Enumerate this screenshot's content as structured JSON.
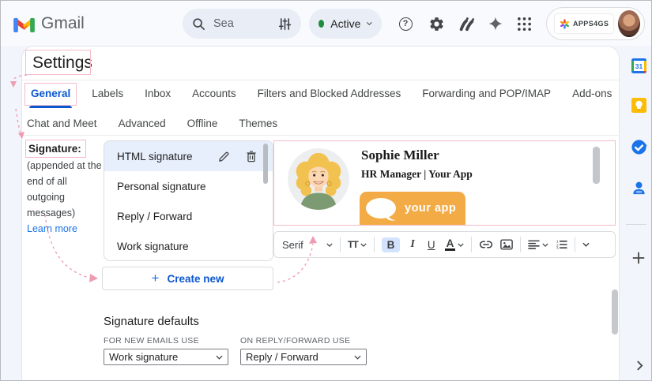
{
  "colors": {
    "annotation_pink": "#ef9fb4",
    "accent_blue": "#0b57d0",
    "banner_orange": "#f3ab45",
    "active_green": "#1e8e3e",
    "selected_row_blue": "#e7eefc"
  },
  "header": {
    "app_name": "Gmail",
    "search_text": "Sea",
    "status_label": "Active",
    "account_badge": "APPS4GS",
    "help_glyph": "?",
    "icons": [
      "search-icon",
      "tune-icon",
      "help-icon",
      "settings-gear-icon",
      "extension-icon",
      "gemini-sparkle-icon",
      "apps-grid-icon",
      "profile-photo"
    ]
  },
  "page": {
    "title": "Settings"
  },
  "tabs": {
    "active": "General",
    "row1": [
      "General",
      "Labels",
      "Inbox",
      "Accounts",
      "Filters and Blocked Addresses",
      "Forwarding and POP/IMAP",
      "Add-ons"
    ],
    "row2": [
      "Chat and Meet",
      "Advanced",
      "Offline",
      "Themes"
    ]
  },
  "signature": {
    "label": "Signature:",
    "note_lines": [
      "(appended at the",
      "end of all outgoing",
      "messages)"
    ],
    "learn_more": "Learn more",
    "list": [
      "HTML signature",
      "Personal signature",
      "Reply / Forward",
      "Work signature"
    ],
    "selected": "HTML signature",
    "create_plus": "+",
    "create_button": "Create new",
    "preview": {
      "name": "Sophie Miller",
      "role": "HR Manager | Your App",
      "banner_text": "your app"
    }
  },
  "toolbar": {
    "font_name": "Serif",
    "size_label": "TT",
    "bold": "B",
    "italic": "I",
    "underline": "U",
    "text_color": "A"
  },
  "defaults": {
    "heading": "Signature defaults",
    "for_new_label": "FOR NEW EMAILS USE",
    "for_new_value": "Work signature",
    "on_reply_label": "ON REPLY/FORWARD USE",
    "on_reply_value": "Reply / Forward"
  },
  "side_panel": {
    "calendar_day": "31",
    "icons": [
      "calendar-icon",
      "keep-icon",
      "tasks-icon",
      "contacts-icon",
      "add-icon",
      "collapse-chevron-icon"
    ]
  }
}
